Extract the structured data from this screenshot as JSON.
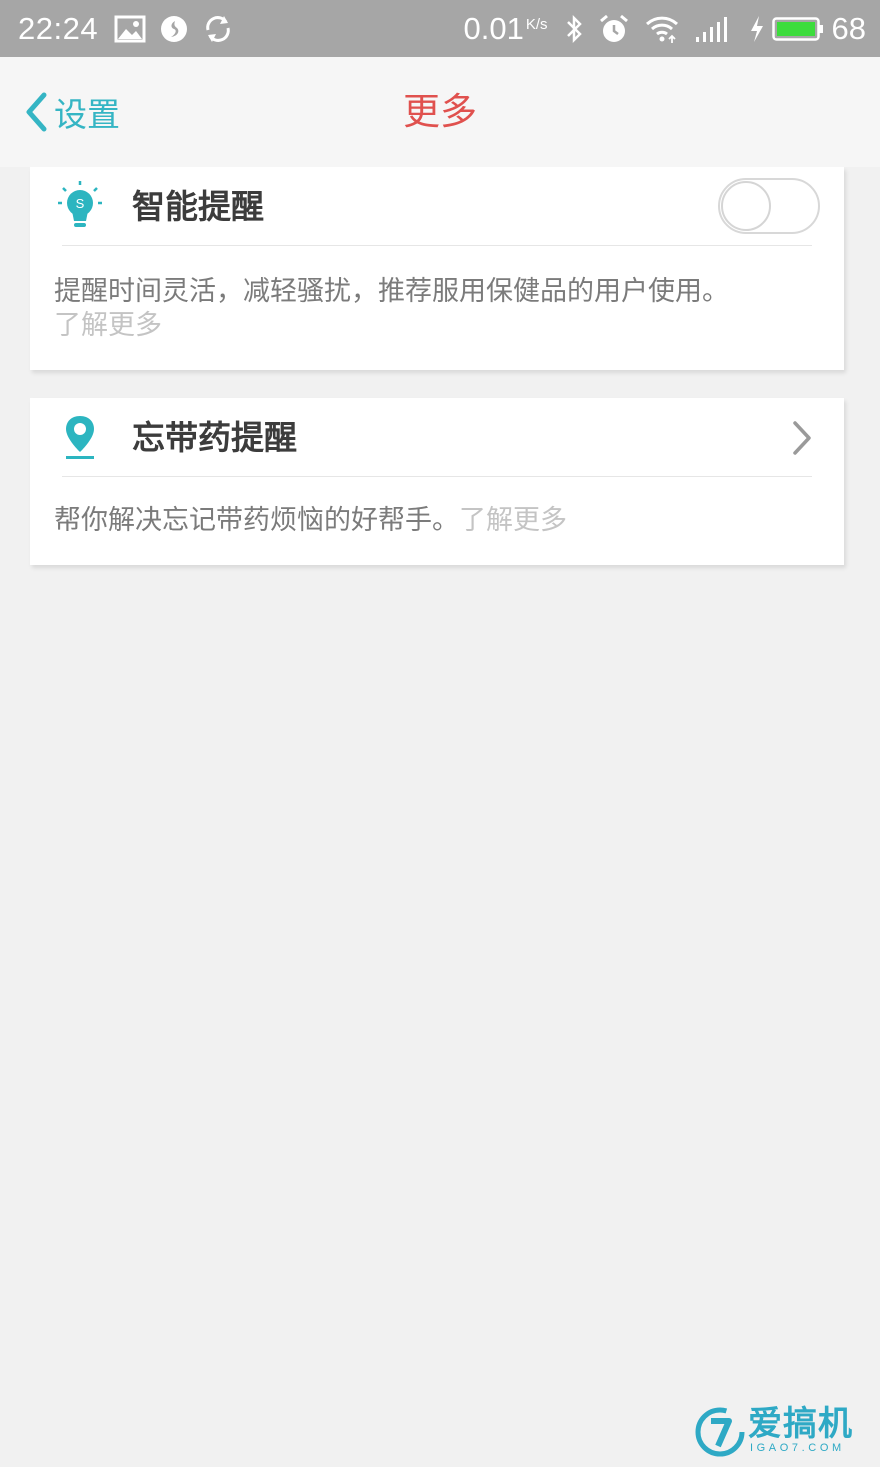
{
  "status_bar": {
    "time": "22:24",
    "net_speed": "0.01",
    "net_speed_unit": "K/s",
    "battery_level": "68",
    "icons": [
      "image-icon",
      "notification-app-icon",
      "sync-icon",
      "bluetooth-icon",
      "alarm-icon",
      "wifi-icon",
      "signal-icon",
      "charging-icon",
      "battery-icon"
    ]
  },
  "nav": {
    "back_label": "设置",
    "title": "更多"
  },
  "cards": [
    {
      "title": "智能提醒",
      "icon": "lightbulb-icon",
      "toggle_on": false,
      "description": "提醒时间灵活，减轻骚扰，推荐服用保健品的用户使用。",
      "learn_more": "了解更多"
    },
    {
      "title": "忘带药提醒",
      "icon": "location-pin-icon",
      "description": "帮你解决忘记带药烦恼的好帮手。",
      "learn_more": "了解更多"
    }
  ],
  "watermark": {
    "text": "爱搞机",
    "subtext": "IGAO7.COM"
  },
  "colors": {
    "accent": "#35b5c4",
    "title_red": "#e0514e",
    "background": "#f1f1f1",
    "status_bar": "#a6a6a6"
  }
}
